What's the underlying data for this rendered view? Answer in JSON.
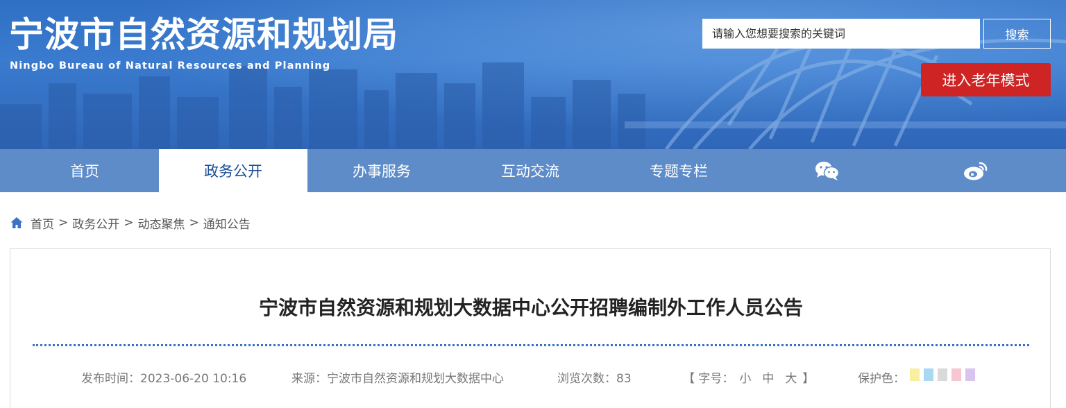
{
  "header": {
    "site_title": "宁波市自然资源和规划局",
    "site_subtitle": "Ningbo Bureau of Natural Resources and Planning",
    "search": {
      "placeholder": "请输入您想要搜索的关键词",
      "button_label": "搜索"
    },
    "elder_mode_label": "进入老年模式"
  },
  "nav": {
    "items": [
      {
        "label": "首页",
        "active": false
      },
      {
        "label": "政务公开",
        "active": true
      },
      {
        "label": "办事服务",
        "active": false
      },
      {
        "label": "互动交流",
        "active": false
      },
      {
        "label": "专题专栏",
        "active": false
      }
    ],
    "icons": [
      "wechat-icon",
      "weibo-icon"
    ]
  },
  "breadcrumb": {
    "icon": "home-icon",
    "items": [
      "首页",
      "政务公开",
      "动态聚焦",
      "通知公告"
    ],
    "separator": ">"
  },
  "article": {
    "title": "宁波市自然资源和规划大数据中心公开招聘编制外工作人员公告",
    "meta": {
      "publish_label": "发布时间：",
      "publish_time": "2023-06-20 10:16",
      "source_label": "来源：",
      "source": "宁波市自然资源和规划大数据中心",
      "views_label": "浏览次数：",
      "views": "83",
      "font_size_open": "【 字号：",
      "font_sizes": [
        "小",
        "中",
        "大"
      ],
      "font_size_close": "】",
      "protect_color_label": "保护色："
    },
    "protect_colors": [
      "#f8efa0",
      "#a9d8f2",
      "#d9d9d9",
      "#f7c6d0",
      "#d9c4ef"
    ]
  },
  "colors": {
    "nav_bg": "#5d8cc9",
    "nav_active_text": "#1a4f96",
    "elder_button": "#cf2424",
    "divider": "#3a6fc3"
  }
}
